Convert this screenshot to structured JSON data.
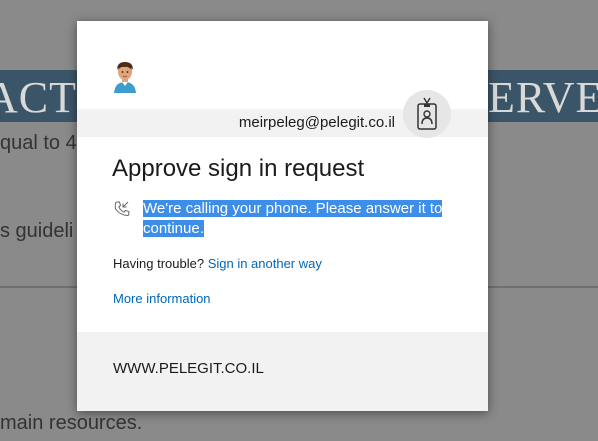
{
  "background": {
    "heading_left": "ACTI",
    "heading_right": "ERVE",
    "line1": "qual to 4",
    "line2": "s guideli",
    "line3": "main resources."
  },
  "dialog": {
    "email": "meirpeleg@pelegit.co.il",
    "title": "Approve sign in request",
    "message": "We're calling your phone. Please answer it to continue.",
    "trouble_text": "Having trouble?",
    "trouble_link": "Sign in another way",
    "more_info": "More information",
    "footer": "WWW.PELEGIT.CO.IL"
  },
  "colors": {
    "link": "#0067b8",
    "selection": "#3d8ee8",
    "strip": "#f2f2f2"
  }
}
